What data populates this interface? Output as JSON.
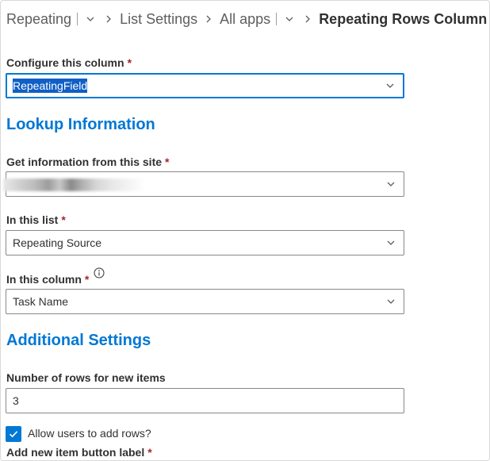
{
  "breadcrumb": {
    "items": [
      "Repeating",
      "List Settings",
      "All apps"
    ],
    "current": "Repeating Rows Column"
  },
  "form": {
    "configure_label": "Configure this column",
    "configure_value": "RepeatingField",
    "required_mark": "*",
    "lookup_section": "Lookup Information",
    "site_label": "Get information from this site",
    "list_label": "In this list",
    "list_value": "Repeating Source",
    "column_label": "In this column",
    "column_value": "Task Name",
    "additional_section": "Additional Settings",
    "rows_label": "Number of rows for new items",
    "rows_value": "3",
    "allow_add_label": "Allow users to add rows?",
    "allow_add_checked": true,
    "add_button_label": "Add new item button label"
  },
  "colors": {
    "accent": "#0078d4",
    "required": "#a4262c",
    "selection": "#0f5fc6"
  },
  "icons": {
    "dropdown": "chevron-down-icon",
    "breadcrumb_separator": "chevron-right-icon",
    "info": "info-icon",
    "check": "checkmark-icon"
  }
}
